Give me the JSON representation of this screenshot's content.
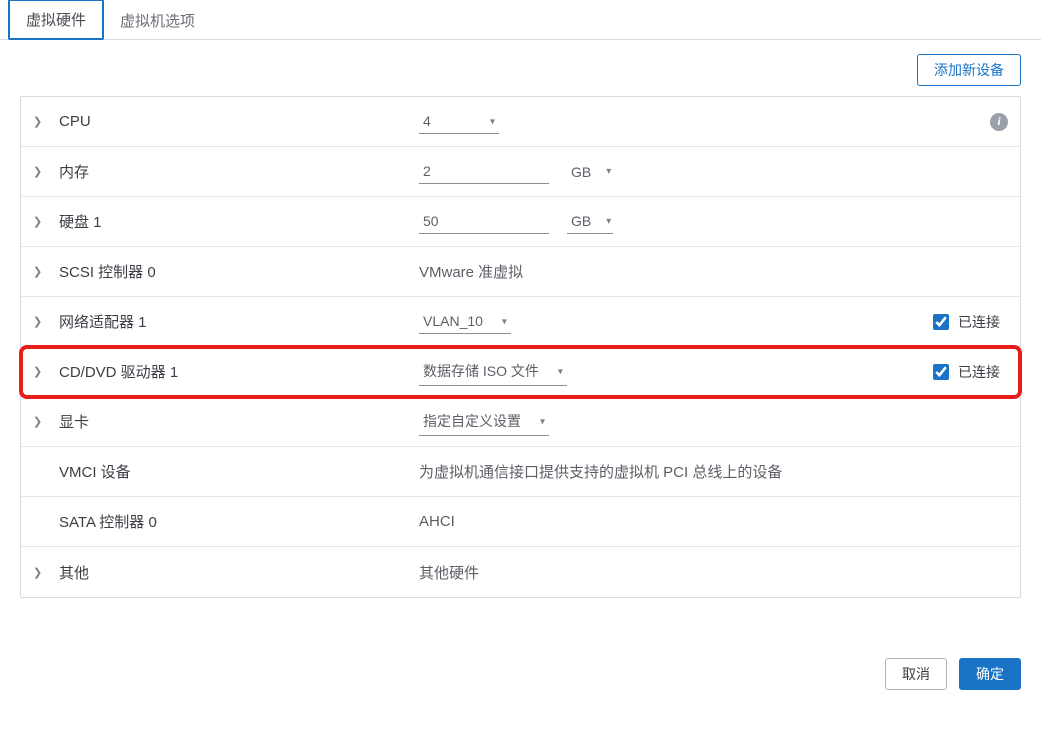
{
  "tabs": {
    "hardware": "虚拟硬件",
    "options": "虚拟机选项"
  },
  "buttons": {
    "add_device": "添加新设备",
    "cancel": "取消",
    "ok": "确定"
  },
  "rows": {
    "cpu": {
      "label": "CPU",
      "value": "4"
    },
    "memory": {
      "label": "内存",
      "value": "2",
      "unit": "GB"
    },
    "disk": {
      "label": "硬盘 1",
      "value": "50",
      "unit": "GB"
    },
    "scsi": {
      "label": "SCSI 控制器 0",
      "text": "VMware 准虚拟"
    },
    "nic": {
      "label": "网络适配器 1",
      "value": "VLAN_10",
      "connected_label": "已连接"
    },
    "cddvd": {
      "label": "CD/DVD 驱动器 1",
      "value": "数据存储 ISO 文件",
      "connected_label": "已连接"
    },
    "gpu": {
      "label": "显卡",
      "value": "指定自定义设置"
    },
    "vmci": {
      "label": "VMCI 设备",
      "text": "为虚拟机通信接口提供支持的虚拟机 PCI 总线上的设备"
    },
    "sata": {
      "label": "SATA 控制器 0",
      "text": "AHCI"
    },
    "other": {
      "label": "其他",
      "text": "其他硬件"
    }
  }
}
